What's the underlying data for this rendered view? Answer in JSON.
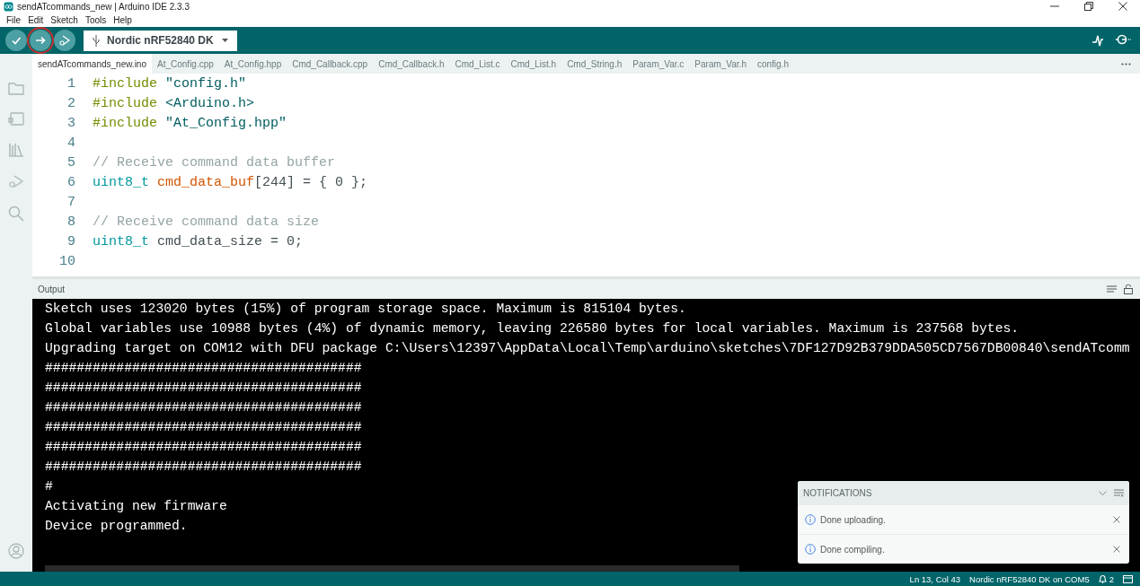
{
  "window": {
    "title": "sendATcommands_new | Arduino IDE 2.3.3"
  },
  "menu": [
    "File",
    "Edit",
    "Sketch",
    "Tools",
    "Help"
  ],
  "toolbar": {
    "buttons": [
      {
        "kind": "verify",
        "highlighted": false
      },
      {
        "kind": "upload",
        "highlighted": true
      },
      {
        "kind": "debug",
        "highlighted": false
      }
    ],
    "board": "Nordic nRF52840 DK"
  },
  "tabs": [
    {
      "label": "sendATcommands_new.ino",
      "selected": true
    },
    {
      "label": "At_Config.cpp",
      "selected": false
    },
    {
      "label": "At_Config.hpp",
      "selected": false
    },
    {
      "label": "Cmd_Callback.cpp",
      "selected": false
    },
    {
      "label": "Cmd_Callback.h",
      "selected": false
    },
    {
      "label": "Cmd_List.c",
      "selected": false
    },
    {
      "label": "Cmd_List.h",
      "selected": false
    },
    {
      "label": "Cmd_String.h",
      "selected": false
    },
    {
      "label": "Param_Var.c",
      "selected": false
    },
    {
      "label": "Param_Var.h",
      "selected": false
    },
    {
      "label": "config.h",
      "selected": false
    }
  ],
  "editor": {
    "lines": [
      {
        "number": "1",
        "tokens": [
          {
            "kind": "directive",
            "text": "#include"
          },
          {
            "kind": "string",
            "text": " \"config.h\""
          }
        ]
      },
      {
        "number": "2",
        "tokens": [
          {
            "kind": "directive",
            "text": "#include"
          },
          {
            "kind": "string",
            "text": " <Arduino.h>"
          }
        ]
      },
      {
        "number": "3",
        "tokens": [
          {
            "kind": "directive",
            "text": "#include"
          },
          {
            "kind": "string",
            "text": " \"At_Config.hpp\""
          }
        ]
      },
      {
        "number": "4"
      },
      {
        "number": "5",
        "tokens": [
          {
            "kind": "comment",
            "text": "// Receive command data buffer"
          }
        ]
      },
      {
        "number": "6",
        "tokens": [
          {
            "kind": "type",
            "text": "uint8_t"
          },
          {
            "kind": "function",
            "text": " cmd_data_buf"
          },
          {
            "kind": "plain",
            "text": "[244] = { 0 };"
          }
        ]
      },
      {
        "number": "7"
      },
      {
        "number": "8",
        "tokens": [
          {
            "kind": "comment",
            "text": "// Receive command data size"
          }
        ]
      },
      {
        "number": "9",
        "tokens": [
          {
            "kind": "type",
            "text": "uint8_t"
          },
          {
            "kind": "plain",
            "text": " cmd_data_size = 0;"
          }
        ]
      },
      {
        "number": "10"
      }
    ]
  },
  "output": {
    "title": "Output",
    "lines": [
      "Sketch uses 123020 bytes (15%) of program storage space. Maximum is 815104 bytes.",
      "Global variables use 10988 bytes (4%) of dynamic memory, leaving 226580 bytes for local variables. Maximum is 237568 bytes.",
      "Upgrading target on COM12 with DFU package C:\\Users\\12397\\AppData\\Local\\Temp\\arduino\\sketches\\7DF127D92B379DDA505CD7567DB00840\\sendATcomm",
      "########################################",
      "########################################",
      "########################################",
      "########################################",
      "########################################",
      "########################################",
      "#",
      "Activating new firmware",
      "Device programmed."
    ]
  },
  "notifications": {
    "title": "NOTIFICATIONS",
    "items": [
      "Done uploading.",
      "Done compiling."
    ]
  },
  "status_bar": {
    "position": "Ln 13, Col 43",
    "board": "Nordic nRF52840 DK on COM5",
    "notification_count": "2"
  }
}
